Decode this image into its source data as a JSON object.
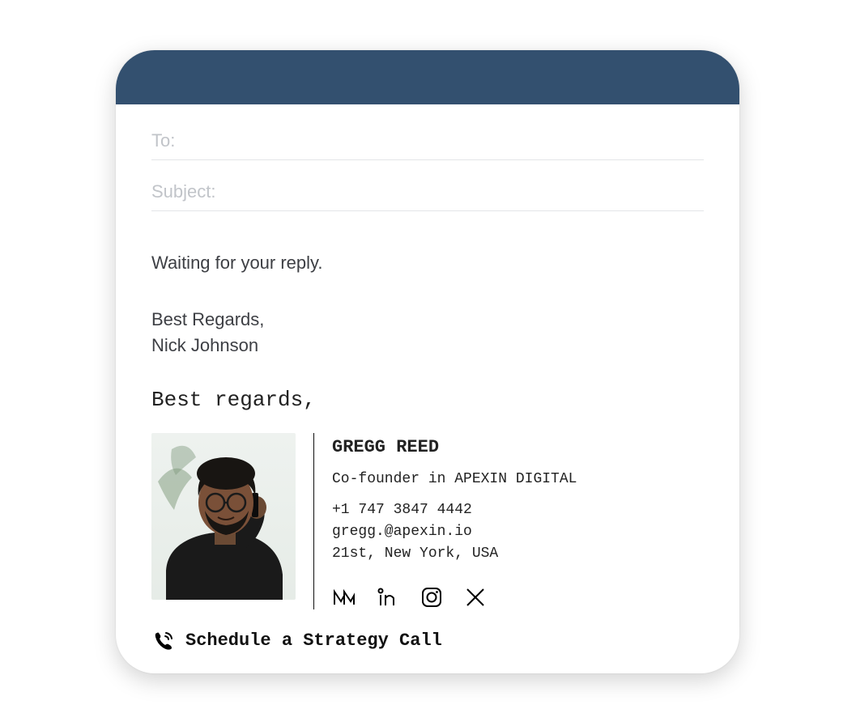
{
  "compose": {
    "to_label": "To:",
    "subject_label": "Subject:"
  },
  "body": {
    "line1": "Waiting for your reply.",
    "closing": "Best Regards,",
    "sender": "Nick Johnson"
  },
  "signature": {
    "greeting": "Best regards,",
    "name": "GREGG REED",
    "role": "Co-founder  in APEXIN DIGITAL",
    "phone": "+1 747 3847 4442",
    "email": "gregg.@apexin.io",
    "address": "21st, New York, USA",
    "socials": {
      "medium": "medium-icon",
      "linkedin": "linkedin-icon",
      "instagram": "instagram-icon",
      "x": "x-twitter-icon"
    },
    "cta_label": "Schedule a Strategy Call"
  },
  "colors": {
    "header": "#33506f",
    "text": "#3d3f44",
    "placeholder": "#c1c4c9"
  }
}
